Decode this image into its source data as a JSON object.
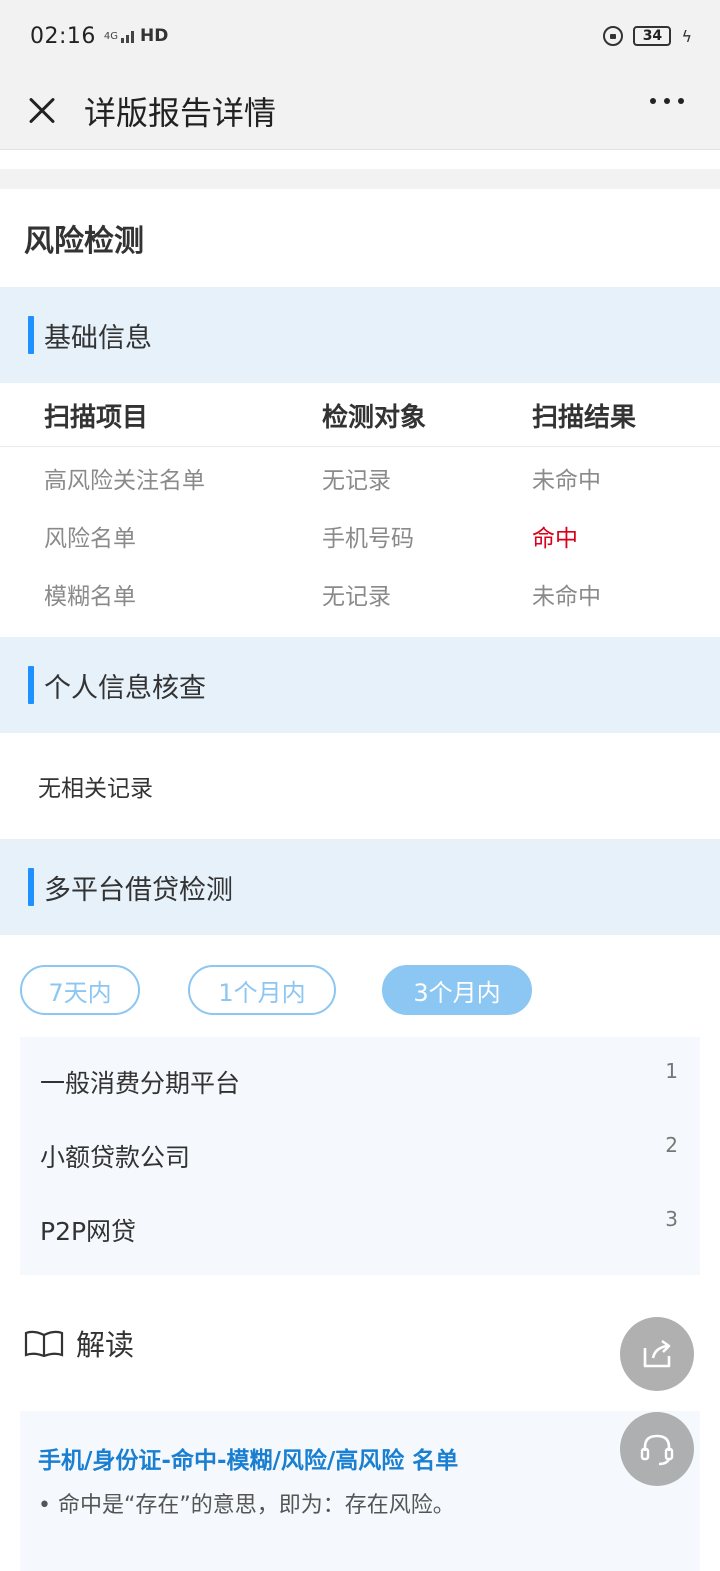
{
  "status_bar": {
    "time": "02:16",
    "network": "4G",
    "hd_label": "HD",
    "battery": "34"
  },
  "nav": {
    "title": "详版报告详情"
  },
  "section": {
    "title": "风险检测"
  },
  "basic_info": {
    "header": "基础信息",
    "columns": [
      "扫描项目",
      "检测对象",
      "扫描结果"
    ],
    "rows": [
      {
        "item": "高风险关注名单",
        "target": "无记录",
        "result": "未命中"
      },
      {
        "item": "风险名单",
        "target": "手机号码",
        "result": "命中"
      },
      {
        "item": "模糊名单",
        "target": "无记录",
        "result": "未命中"
      }
    ]
  },
  "personal_check": {
    "header": "个人信息核查",
    "text": "无相关记录"
  },
  "multi_platform": {
    "header": "多平台借贷检测",
    "tabs": [
      {
        "label": "7天内"
      },
      {
        "label": "1个月内"
      },
      {
        "label": "3个月内"
      }
    ],
    "active_tab": "3个月内",
    "items": [
      {
        "name": "一般消费分期平台",
        "count": "1"
      },
      {
        "name": "小额贷款公司",
        "count": "2"
      },
      {
        "name": "P2P网贷",
        "count": "3"
      }
    ]
  },
  "interpretation": {
    "title": "解读",
    "headline": "手机/身份证-命中-模糊/风险/高风险 名单",
    "line1": "• 命中是“存在”的意思，即为：存在风险。"
  },
  "colors": {
    "accent": "#1e90ff",
    "hit": "#d9001b",
    "header_bg": "#e6f1fa",
    "tab": "#8cc6f2"
  }
}
